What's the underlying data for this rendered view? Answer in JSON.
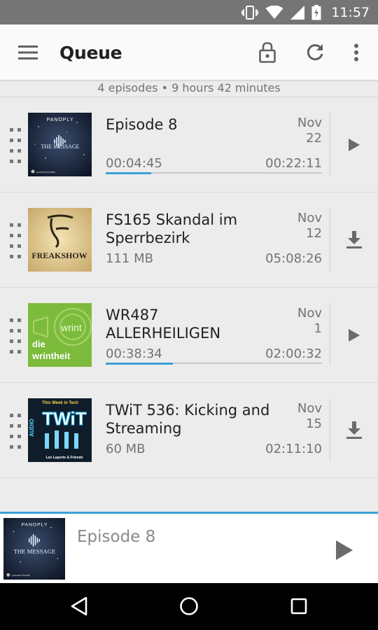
{
  "status_bar": {
    "time": "11:57",
    "icons": [
      "vibrate-icon",
      "wifi-icon",
      "signal-icon",
      "battery-icon"
    ]
  },
  "app_bar": {
    "title": "Queue",
    "icons": [
      "menu-icon",
      "lock-icon",
      "refresh-icon",
      "overflow-icon"
    ]
  },
  "summary": {
    "text": "4 episodes • 9 hours 42 minutes"
  },
  "queue": [
    {
      "title": "Episode 8",
      "date_month": "Nov",
      "date_day": "22",
      "left_text": "00:04:45",
      "right_text": "00:22:11",
      "progress_fraction": 0.21,
      "action": "play-icon",
      "cover": {
        "brand": "PANOPLY",
        "show": "THE MESSAGE",
        "footer": "podcast theater"
      }
    },
    {
      "title": "FS165 Skandal im Sperrbezirk",
      "date_month": "Nov",
      "date_day": "12",
      "left_text": "111 MB",
      "right_text": "05:08:26",
      "progress_fraction": null,
      "action": "download-icon",
      "cover": {
        "show": "FREAKSHOW"
      }
    },
    {
      "title": "WR487 ALLERHEILIGEN",
      "date_month": "Nov",
      "date_day": "1",
      "left_text": "00:38:34",
      "right_text": "02:00:32",
      "progress_fraction": 0.31,
      "action": "play-icon",
      "cover": {
        "tag": "wrint",
        "show_line1": "die",
        "show_line2": "wrintheit"
      }
    },
    {
      "title": "TWiT 536: Kicking and Streaming",
      "date_month": "Nov",
      "date_day": "15",
      "left_text": "60 MB",
      "right_text": "02:11:10",
      "progress_fraction": null,
      "action": "download-icon",
      "cover": {
        "header": "This Week in Tech",
        "side": "AUDIO",
        "show": "TWiT",
        "footer": "Leo Laporte & Friends"
      }
    }
  ],
  "mini_player": {
    "title": "Episode 8",
    "action": "play-icon",
    "cover": {
      "brand": "PANOPLY",
      "show": "THE MESSAGE",
      "footer": "podcast theater"
    }
  },
  "nav_bar": {
    "icons": [
      "back-icon",
      "home-icon",
      "recents-icon"
    ]
  },
  "colors": {
    "accent": "#3aa0d8",
    "status_bar": "#757575",
    "background": "#ececec",
    "text_primary": "#212121",
    "text_secondary": "#737373"
  }
}
